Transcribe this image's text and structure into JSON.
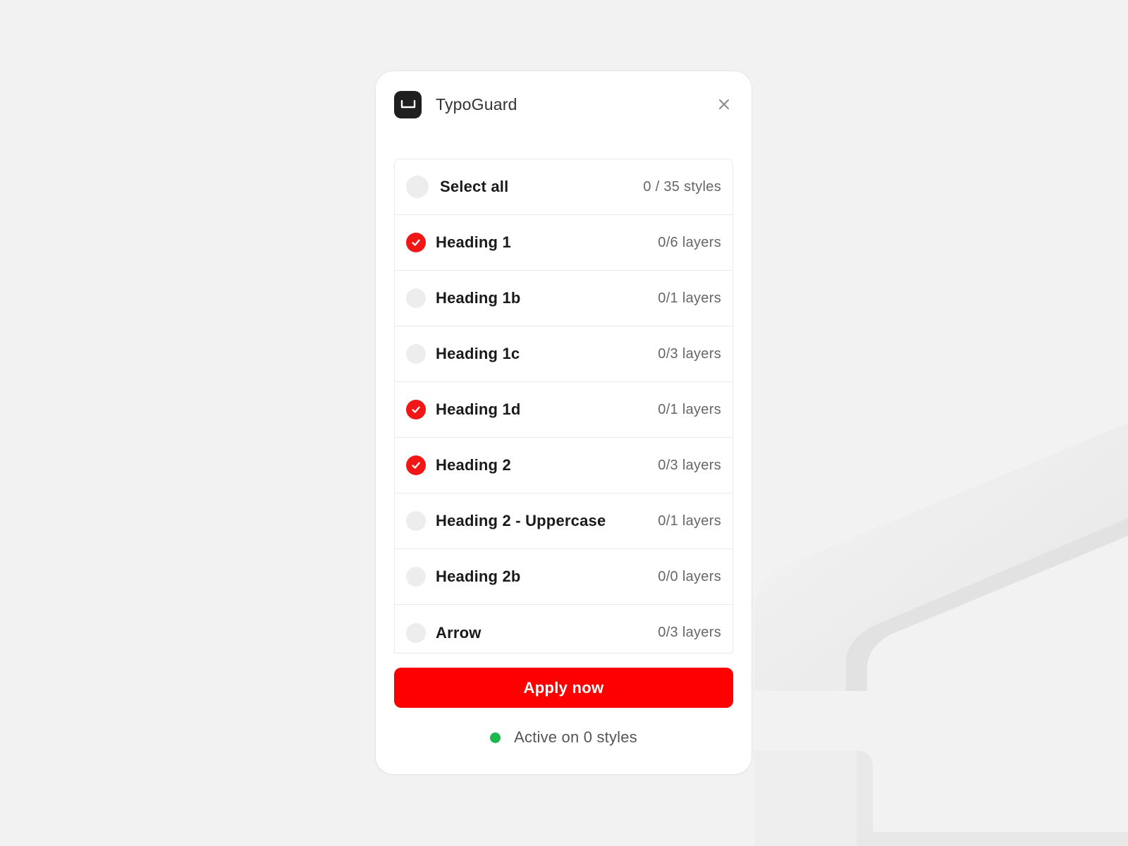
{
  "app": {
    "title": "TypoGuard",
    "logo_icon": "space-bar-icon",
    "close_icon": "close-icon"
  },
  "select_all": {
    "label": "Select all",
    "count": "0 / 35 styles",
    "checked": false
  },
  "styles": [
    {
      "label": "Heading 1",
      "count": "0/6 layers",
      "checked": true
    },
    {
      "label": "Heading 1b",
      "count": "0/1 layers",
      "checked": false
    },
    {
      "label": "Heading 1c",
      "count": "0/3 layers",
      "checked": false
    },
    {
      "label": "Heading 1d",
      "count": "0/1 layers",
      "checked": true
    },
    {
      "label": "Heading 2",
      "count": "0/3 layers",
      "checked": true
    },
    {
      "label": "Heading 2 - Uppercase",
      "count": "0/1 layers",
      "checked": false
    },
    {
      "label": "Heading 2b",
      "count": "0/0 layers",
      "checked": false
    },
    {
      "label": "Arrow",
      "count": "0/3 layers",
      "checked": false
    }
  ],
  "apply_button": {
    "label": "Apply now"
  },
  "status": {
    "text": "Active on 0 styles",
    "dot_color": "#1bb84d"
  },
  "colors": {
    "accent": "#ff0000",
    "check_on": "#f21717",
    "check_off": "#ededed"
  }
}
